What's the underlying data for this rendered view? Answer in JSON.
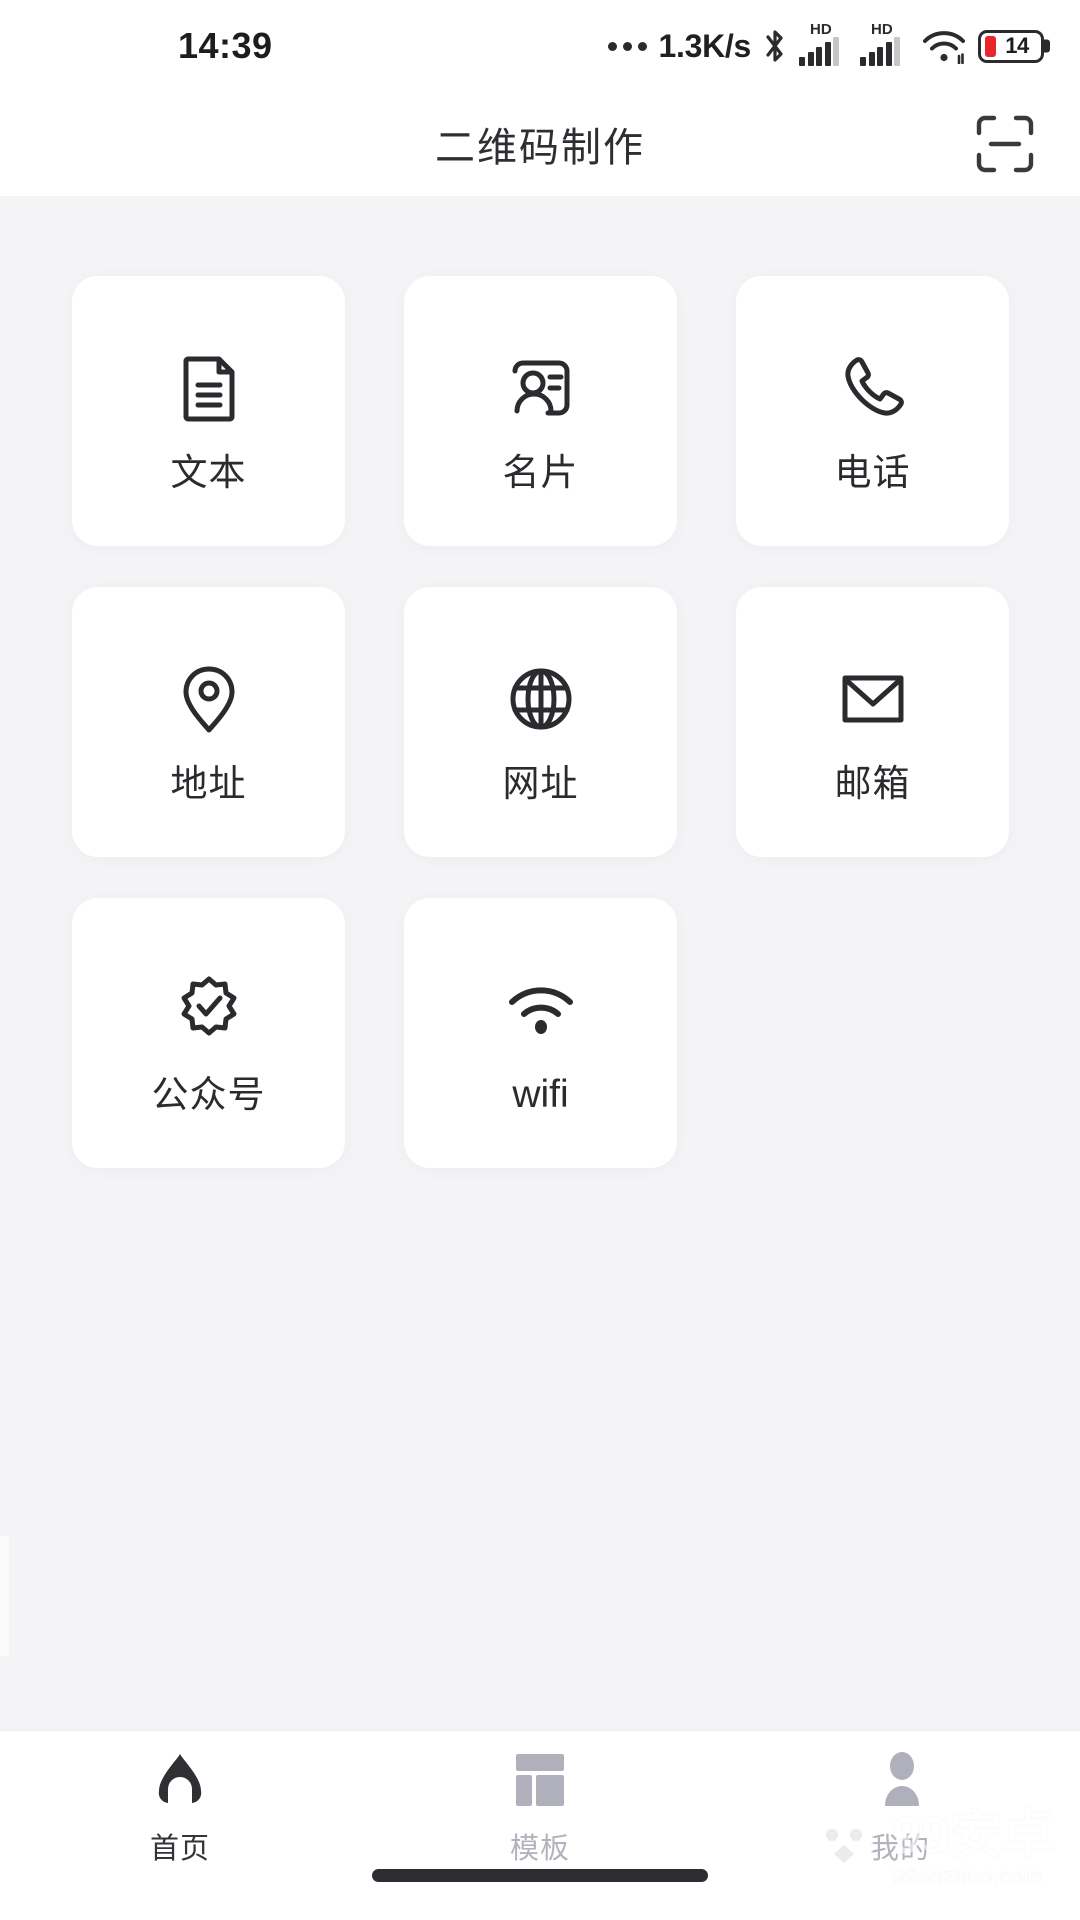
{
  "status_bar": {
    "time": "14:39",
    "network_speed": "1.3K/s",
    "bluetooth_icon": "bluetooth-icon",
    "signal_1": {
      "label": "HD",
      "bars": 4
    },
    "signal_2": {
      "label": "HD",
      "bars": 4
    },
    "wifi_icon": "wifi-icon",
    "battery_level": "14",
    "battery_color": "#e8262b"
  },
  "header": {
    "title": "二维码制作",
    "scan_icon": "scan-frame-icon"
  },
  "grid": {
    "items": [
      {
        "label": "文本",
        "icon": "document-icon"
      },
      {
        "label": "名片",
        "icon": "contact-card-icon"
      },
      {
        "label": "电话",
        "icon": "phone-icon"
      },
      {
        "label": "地址",
        "icon": "location-pin-icon"
      },
      {
        "label": "网址",
        "icon": "globe-icon"
      },
      {
        "label": "邮箱",
        "icon": "envelope-icon"
      },
      {
        "label": "公众号",
        "icon": "verified-badge-icon"
      },
      {
        "label": "wifi",
        "icon": "wifi-icon"
      }
    ]
  },
  "tabbar": {
    "items": [
      {
        "label": "首页",
        "icon": "home-icon",
        "active": true
      },
      {
        "label": "模板",
        "icon": "template-icon",
        "active": false
      },
      {
        "label": "我的",
        "icon": "person-icon",
        "active": false
      }
    ],
    "active_color": "#333338",
    "inactive_color": "#b3b3bd"
  },
  "watermark": {
    "main": "99安卓",
    "sub": "99anzhuo.com"
  }
}
